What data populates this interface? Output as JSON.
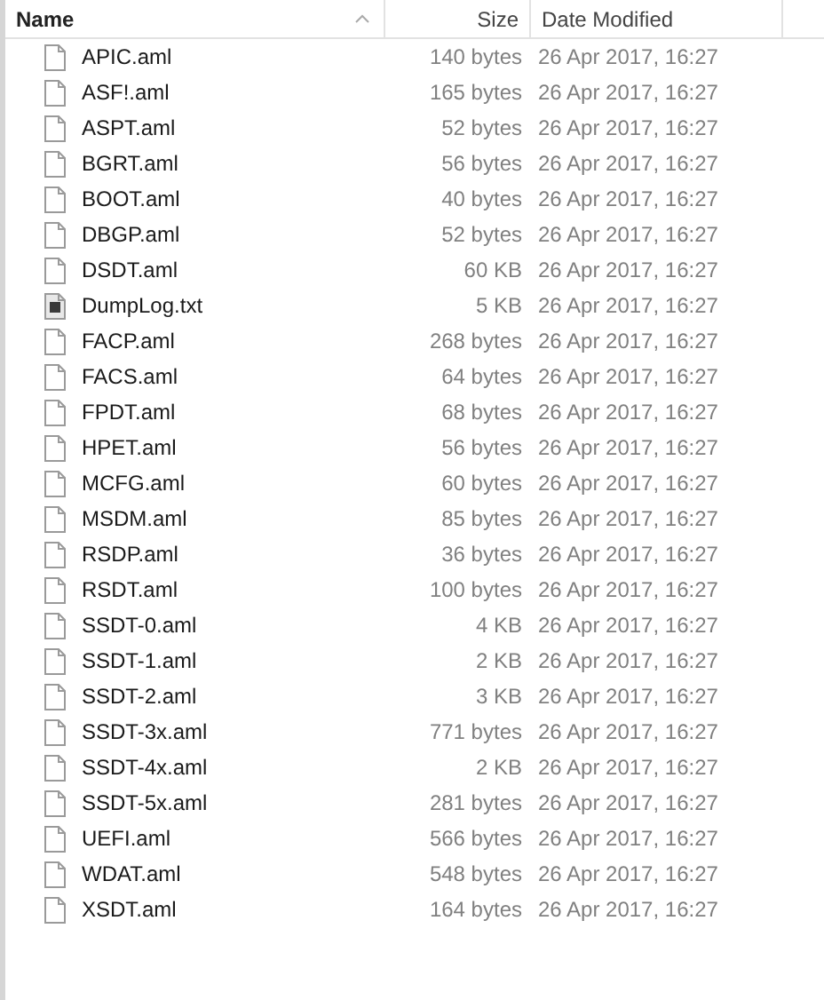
{
  "columns": [
    {
      "label": "Name",
      "sorted": true
    },
    {
      "label": "Size",
      "sorted": false
    },
    {
      "label": "Date Modified",
      "sorted": false
    }
  ],
  "files": [
    {
      "name": "APIC.aml",
      "size": "140 bytes",
      "modified": "26 Apr 2017, 16:27",
      "kind": "document"
    },
    {
      "name": "ASF!.aml",
      "size": "165 bytes",
      "modified": "26 Apr 2017, 16:27",
      "kind": "document"
    },
    {
      "name": "ASPT.aml",
      "size": "52 bytes",
      "modified": "26 Apr 2017, 16:27",
      "kind": "document"
    },
    {
      "name": "BGRT.aml",
      "size": "56 bytes",
      "modified": "26 Apr 2017, 16:27",
      "kind": "document"
    },
    {
      "name": "BOOT.aml",
      "size": "40 bytes",
      "modified": "26 Apr 2017, 16:27",
      "kind": "document"
    },
    {
      "name": "DBGP.aml",
      "size": "52 bytes",
      "modified": "26 Apr 2017, 16:27",
      "kind": "document"
    },
    {
      "name": "DSDT.aml",
      "size": "60 KB",
      "modified": "26 Apr 2017, 16:27",
      "kind": "document"
    },
    {
      "name": "DumpLog.txt",
      "size": "5 KB",
      "modified": "26 Apr 2017, 16:27",
      "kind": "text"
    },
    {
      "name": "FACP.aml",
      "size": "268 bytes",
      "modified": "26 Apr 2017, 16:27",
      "kind": "document"
    },
    {
      "name": "FACS.aml",
      "size": "64 bytes",
      "modified": "26 Apr 2017, 16:27",
      "kind": "document"
    },
    {
      "name": "FPDT.aml",
      "size": "68 bytes",
      "modified": "26 Apr 2017, 16:27",
      "kind": "document"
    },
    {
      "name": "HPET.aml",
      "size": "56 bytes",
      "modified": "26 Apr 2017, 16:27",
      "kind": "document"
    },
    {
      "name": "MCFG.aml",
      "size": "60 bytes",
      "modified": "26 Apr 2017, 16:27",
      "kind": "document"
    },
    {
      "name": "MSDM.aml",
      "size": "85 bytes",
      "modified": "26 Apr 2017, 16:27",
      "kind": "document"
    },
    {
      "name": "RSDP.aml",
      "size": "36 bytes",
      "modified": "26 Apr 2017, 16:27",
      "kind": "document"
    },
    {
      "name": "RSDT.aml",
      "size": "100 bytes",
      "modified": "26 Apr 2017, 16:27",
      "kind": "document"
    },
    {
      "name": "SSDT-0.aml",
      "size": "4 KB",
      "modified": "26 Apr 2017, 16:27",
      "kind": "document"
    },
    {
      "name": "SSDT-1.aml",
      "size": "2 KB",
      "modified": "26 Apr 2017, 16:27",
      "kind": "document"
    },
    {
      "name": "SSDT-2.aml",
      "size": "3 KB",
      "modified": "26 Apr 2017, 16:27",
      "kind": "document"
    },
    {
      "name": "SSDT-3x.aml",
      "size": "771 bytes",
      "modified": "26 Apr 2017, 16:27",
      "kind": "document"
    },
    {
      "name": "SSDT-4x.aml",
      "size": "2 KB",
      "modified": "26 Apr 2017, 16:27",
      "kind": "document"
    },
    {
      "name": "SSDT-5x.aml",
      "size": "281 bytes",
      "modified": "26 Apr 2017, 16:27",
      "kind": "document"
    },
    {
      "name": "UEFI.aml",
      "size": "566 bytes",
      "modified": "26 Apr 2017, 16:27",
      "kind": "document"
    },
    {
      "name": "WDAT.aml",
      "size": "548 bytes",
      "modified": "26 Apr 2017, 16:27",
      "kind": "document"
    },
    {
      "name": "XSDT.aml",
      "size": "164 bytes",
      "modified": "26 Apr 2017, 16:27",
      "kind": "document"
    }
  ]
}
